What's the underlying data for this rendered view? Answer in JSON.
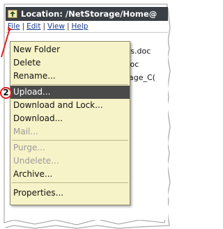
{
  "window": {
    "title": "Location: /NetStorage/Home@",
    "title_icon": "folder-up-icon"
  },
  "menubar": {
    "items": [
      "File",
      "Edit",
      "View",
      "Help"
    ],
    "separator": "|"
  },
  "files": [
    "ers.doc",
    ".doc",
    "Jsage_C("
  ],
  "file_menu": {
    "items": [
      {
        "label": "New Folder",
        "enabled": true
      },
      {
        "label": "Delete",
        "enabled": true
      },
      {
        "label": "Rename...",
        "enabled": true
      },
      {
        "label": "Upload...",
        "enabled": true,
        "selected": true
      },
      {
        "label": "Download and Lock...",
        "enabled": true
      },
      {
        "label": "Download...",
        "enabled": true
      },
      {
        "label": "Mail...",
        "enabled": false
      },
      {
        "label": "Purge...",
        "enabled": false
      },
      {
        "label": "Undelete...",
        "enabled": false
      },
      {
        "label": "Archive...",
        "enabled": true
      },
      {
        "label": "Properties...",
        "enabled": true
      }
    ]
  },
  "callout": {
    "number": "2",
    "color": "#e02020"
  },
  "colors": {
    "titlebar": "#3a3f45",
    "menu_background": "#f7f3c8",
    "selected_item": "#4a4a4a",
    "link": "#1a3a8c"
  }
}
